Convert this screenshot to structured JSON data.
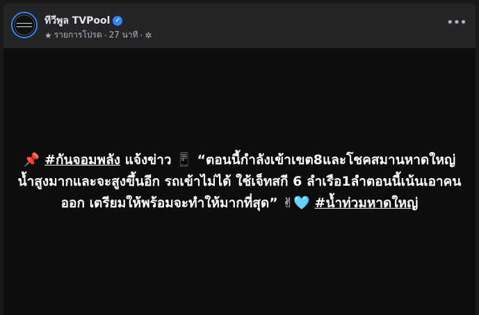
{
  "header": {
    "page_name": "ทีวีพูล TVPool",
    "verified_symbol": "✓",
    "meta_link": "รายการโปรด",
    "separator": "·",
    "time": "27 นาที",
    "more_symbol": "•••"
  },
  "post": {
    "pin_emoji": "📌",
    "hashtag_1": "#กันจอมพลัง",
    "text_intro": " แจ้งข่าว ",
    "phone_emoji": "📱",
    "quote": " “ตอนนี้กำลังเข้าเขต8และโชคสมานหาดใหญ่น้ำสูงมากและจะสูงขึ้นอีก รถเข้าไม่ได้ ใช้เจ็ทสกี 6 ลำเรือ1ลำตอนนี้เน้นเอาคนออก เตรียมให้พร้อมจะทำให้มากที่สุด” ",
    "victory_emoji": "✌",
    "heart_emoji": "🩵",
    "hashtag_2": "#น้ำท่วมหาดใหญ่"
  },
  "icons": {
    "star": "favorites-star",
    "gear": "privacy-gear",
    "more": "more-options"
  },
  "colors": {
    "accent": "#2d88ff",
    "card": "#242526",
    "body": "#0d0d0d"
  }
}
